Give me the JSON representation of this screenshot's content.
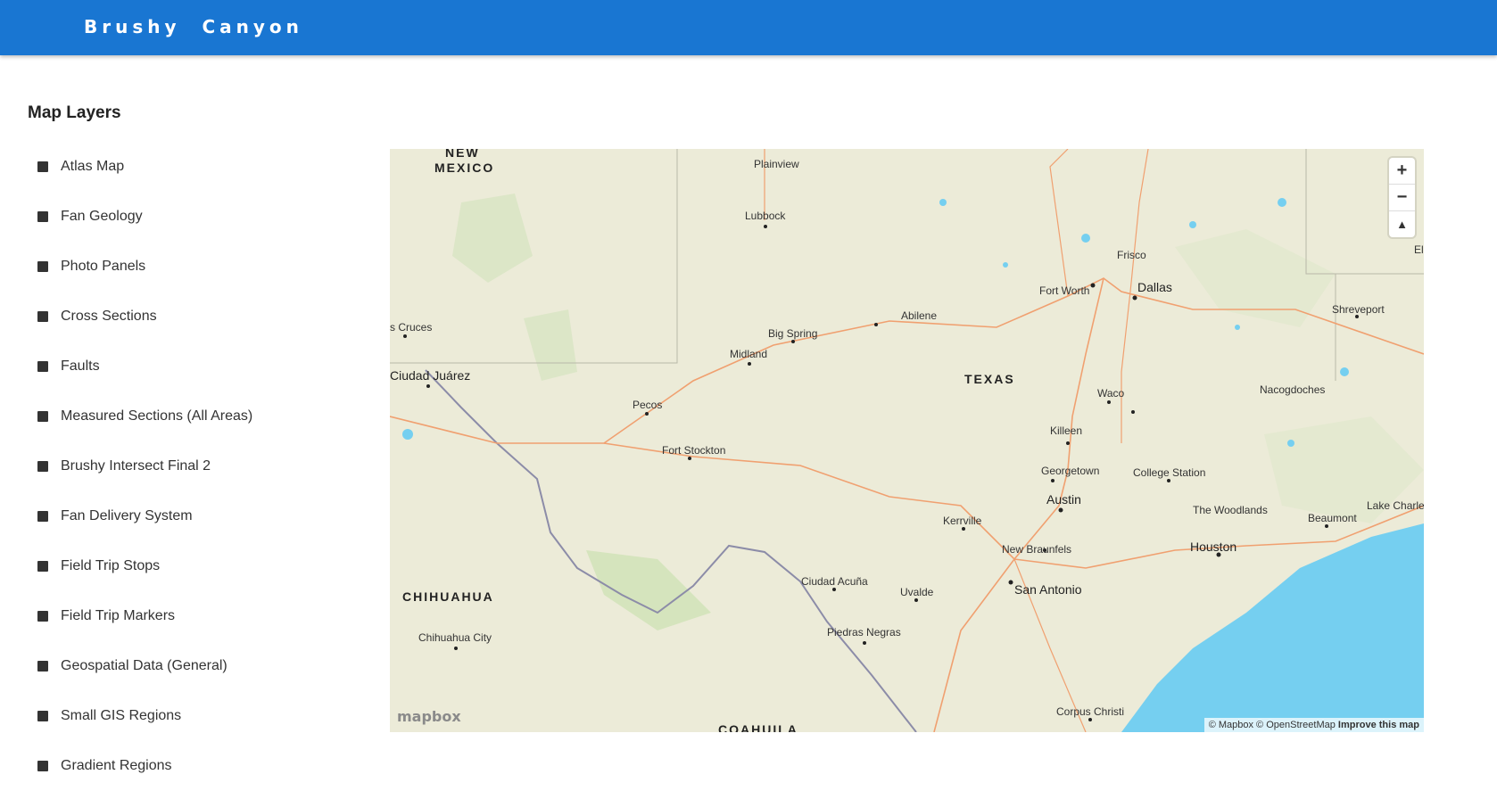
{
  "app": {
    "title": "Brushy  Canyon"
  },
  "panel": {
    "title": "Map Layers",
    "layers": [
      "Atlas Map",
      "Fan Geology",
      "Photo Panels",
      "Cross Sections",
      "Faults",
      "Measured Sections (All Areas)",
      "Brushy Intersect Final 2",
      "Fan Delivery System",
      "Field Trip Stops",
      "Field Trip Markers",
      "Geospatial Data (General)",
      "Small GIS Regions",
      "Gradient Regions"
    ]
  },
  "map": {
    "labels": {
      "new_mexico_1": "NEW",
      "new_mexico_2": "MEXICO",
      "plainview": "Plainview",
      "lubbock": "Lubbock",
      "frisco": "Frisco",
      "el": "El",
      "fort_worth": "Fort Worth",
      "dallas": "Dallas",
      "shreveport": "Shreveport",
      "las_cruces": "s Cruces",
      "abilene": "Abilene",
      "big_spring": "Big Spring",
      "midland": "Midland",
      "ciudad_juarez": "Ciudad Juárez",
      "texas": "TEXAS",
      "waco": "Waco",
      "nacogdoches": "Nacogdoches",
      "pecos": "Pecos",
      "killeen": "Killeen",
      "fort_stockton": "Fort Stockton",
      "georgetown": "Georgetown",
      "college_station": "College Station",
      "austin": "Austin",
      "the_woodlands": "The Woodlands",
      "lake_charles": "Lake Charle",
      "kerrville": "Kerrville",
      "beaumont": "Beaumont",
      "new_braunfels": "New Braunfels",
      "houston": "Houston",
      "ciudad_acuna": "Ciudad Acuña",
      "uvalde": "Uvalde",
      "san_antonio": "San Antonio",
      "chihuahua": "CHIHUAHUA",
      "chihuahua_city": "Chihuahua City",
      "piedras_negras": "Piedras Negras",
      "corpus_christi": "Corpus Christi",
      "coahuila": "COAHUILA"
    },
    "zoom_in": "+",
    "zoom_out": "−",
    "compass": "▲",
    "logo": "mapbox",
    "attribution": "© Mapbox © OpenStreetMap",
    "improve": "Improve this map",
    "colors": {
      "land": "#ecebd8",
      "water": "#75cff0",
      "roads": "#f0a070",
      "border": "#8c8ca8"
    }
  }
}
